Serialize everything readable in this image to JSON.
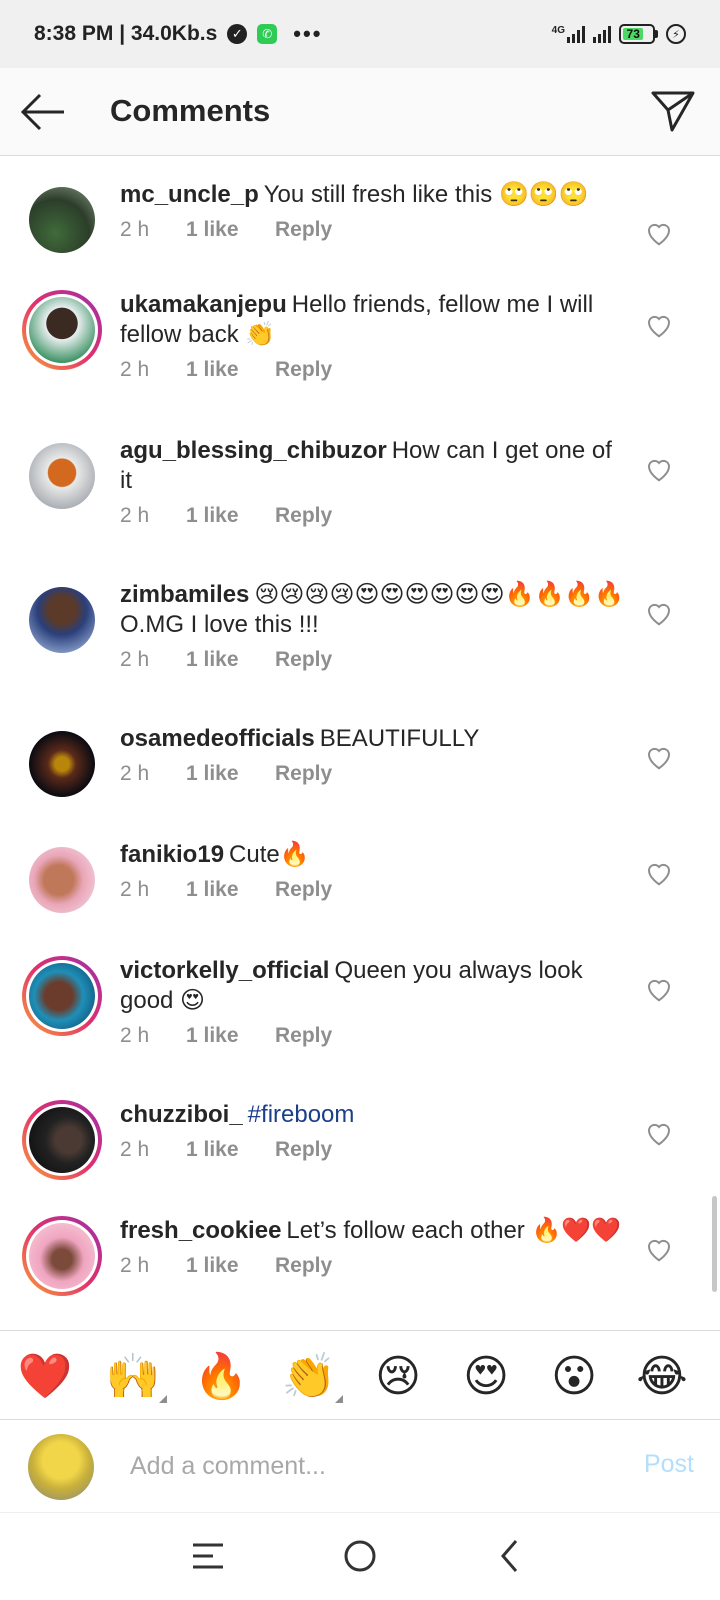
{
  "status_bar": {
    "time_speed": "8:38 PM | 34.0Kb.s",
    "network": "4G",
    "battery": "73",
    "icons": [
      "verified-icon",
      "whatsapp-icon",
      "more-dots-icon",
      "signal-4g-icon",
      "signal-icon",
      "battery-icon",
      "charging-icon"
    ]
  },
  "header": {
    "title": "Comments",
    "icons": [
      "back-arrow-icon",
      "send-icon"
    ]
  },
  "comments": [
    {
      "username": "mc_uncle_p",
      "text": "You still fresh like this 🙄🙄🙄",
      "time": "2 h",
      "likes": "1 like",
      "reply": "Reply"
    },
    {
      "username": "ukamakanjepu",
      "text": "Hello friends, fellow me I will fellow back 👏",
      "time": "2 h",
      "likes": "1 like",
      "reply": "Reply"
    },
    {
      "username": "agu_blessing_chibuzor",
      "text": "How can I get one of it",
      "time": "2 h",
      "likes": "1 like",
      "reply": "Reply"
    },
    {
      "username": "zimbamiles",
      "text": "😢😢😢😢😍😍😍😍😍😍🔥🔥🔥🔥O.MG I love this !!!",
      "time": "2 h",
      "likes": "1 like",
      "reply": "Reply"
    },
    {
      "username": "osamedeofficials",
      "text": "BEAUTIFULLY",
      "time": "2 h",
      "likes": "1 like",
      "reply": "Reply"
    },
    {
      "username": "fanikio19",
      "text": "Cute🔥",
      "time": "2 h",
      "likes": "1 like",
      "reply": "Reply"
    },
    {
      "username": "victorkelly_official",
      "text": "Queen you always look good 😍",
      "time": "2 h",
      "likes": "1 like",
      "reply": "Reply"
    },
    {
      "username": "chuzziboi_",
      "text": "#fireboom",
      "time": "2 h",
      "likes": "1 like",
      "reply": "Reply"
    },
    {
      "username": "fresh_cookiee",
      "text": "Let’s follow each other 🔥❤️❤️",
      "time": "2 h",
      "likes": "1 like",
      "reply": "Reply"
    }
  ],
  "emoji_bar": [
    "❤️",
    "🙌",
    "🔥",
    "👏",
    "😢",
    "😍",
    "😮",
    "😂"
  ],
  "composer": {
    "placeholder": "Add a comment...",
    "post_label": "Post"
  },
  "navbar": {
    "icons": [
      "menu-icon",
      "home-circle-icon",
      "back-chevron-icon"
    ]
  },
  "colors": {
    "accent_link": "#1c3f8c",
    "post_disabled": "#b2dffc",
    "meta_gray": "#8e8e8e",
    "story_ring": "#e1306c"
  }
}
